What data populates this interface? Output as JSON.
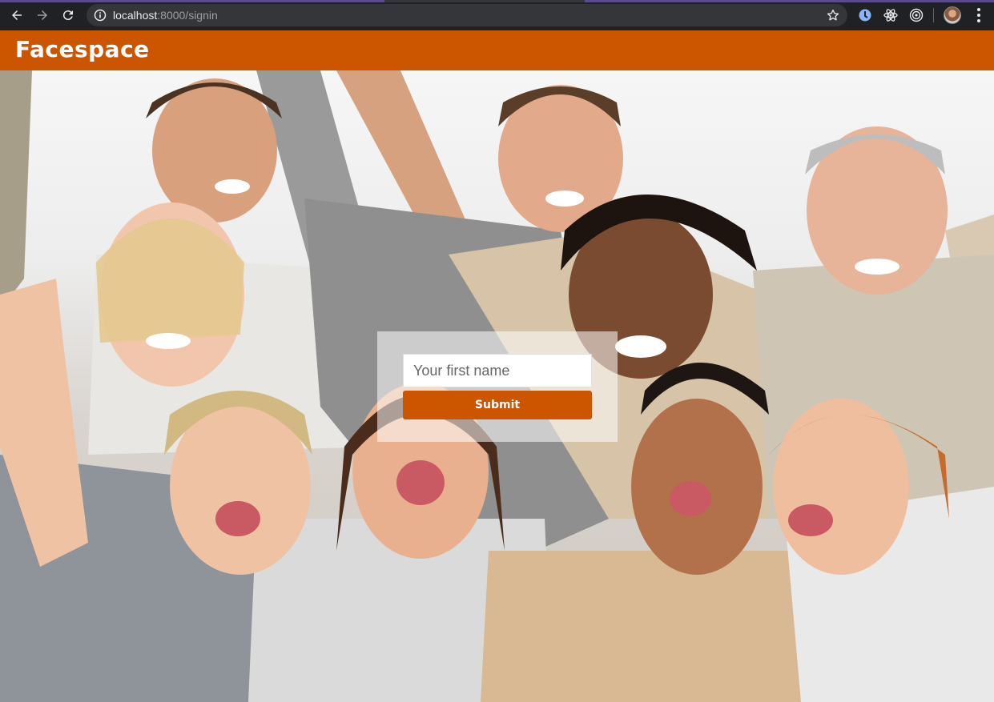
{
  "browser": {
    "url_host": "localhost",
    "url_rest": ":8000/signin",
    "back_icon": "arrow-left-icon",
    "forward_icon": "arrow-right-icon",
    "reload_icon": "reload-icon",
    "info_icon": "info-circle-icon",
    "bookmark_icon": "star-icon",
    "extensions": [
      "extension-blue-icon",
      "react-devtools-icon",
      "target-icon"
    ],
    "menu_icon": "kebab-menu-icon"
  },
  "app": {
    "brand": "Facespace",
    "brand_color": "#cc5500"
  },
  "hero": {
    "description_icon": "crowd-photo"
  },
  "signin": {
    "name_placeholder": "Your first name",
    "name_value": "",
    "submit_label": "Submit"
  }
}
